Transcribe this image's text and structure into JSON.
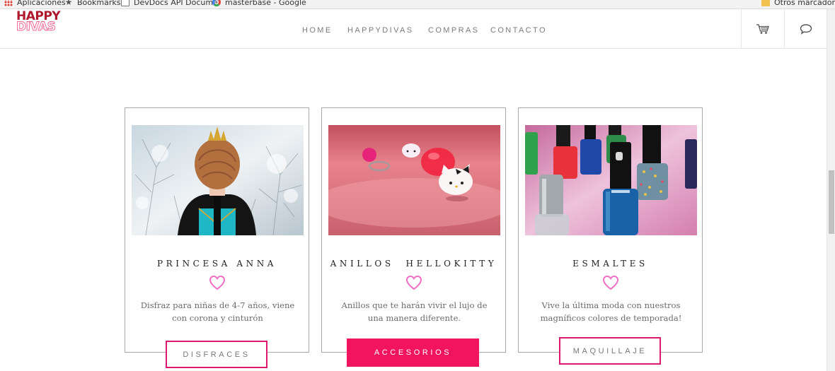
{
  "bookmarks": {
    "items": [
      {
        "label": "Aplicaciones",
        "icon": "apps-icon"
      },
      {
        "label": "Bookmarks",
        "icon": "star-icon"
      },
      {
        "label": "DevDocs API Docume",
        "icon": "document-icon"
      },
      {
        "label": "masterbase - Google",
        "icon": "google-icon"
      }
    ],
    "other": {
      "label": "Otros marcadores",
      "icon": "folder-icon"
    }
  },
  "header": {
    "logo": {
      "line1": "HAPPY",
      "line2": "DIVAS"
    },
    "nav": [
      "HOME",
      "HAPPYDIVAS",
      "COMPRAS",
      "CONTACTO"
    ],
    "tools": [
      {
        "icon": "cart-icon"
      },
      {
        "icon": "chat-icon"
      }
    ]
  },
  "colors": {
    "accent": "#f2145f",
    "accent_border": "#e0176e",
    "logo_red": "#b0182d",
    "logo_pink": "#f2678f"
  },
  "cards": [
    {
      "title": "PRINCESA ANNA",
      "image": "girl-with-crown-photo",
      "description": "Disfraz para niñas de 4-7 años, viene con corona y cinturón",
      "button": "DISFRACES",
      "button_style": "outline"
    },
    {
      "title": "ANILLOS  HELLOKITTY",
      "image": "hello-kitty-rings-photo",
      "description": "Anillos que te harán vivir el lujo de una manera diferente.",
      "button": "ACCESORIOS",
      "button_style": "solid"
    },
    {
      "title": "ESMALTES",
      "image": "nail-polish-photo",
      "description": "Vive la última moda con nuestros magníficos colores de temporada!",
      "button": "MAQUILLAJE",
      "button_style": "outline"
    }
  ]
}
